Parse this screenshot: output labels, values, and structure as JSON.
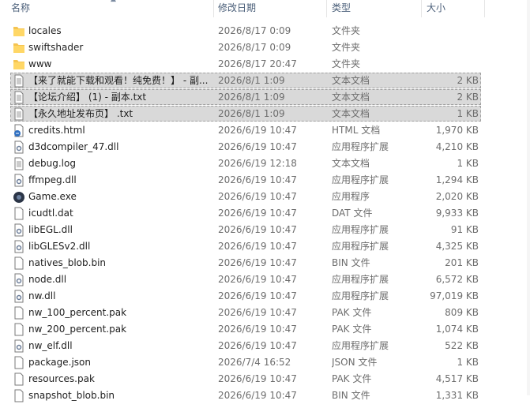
{
  "header": {
    "name": "名称",
    "date": "修改日期",
    "type": "类型",
    "size": "大小"
  },
  "rows": [
    {
      "name": "locales",
      "date": "2026/8/17 0:09",
      "type": "文件夹",
      "size": "",
      "icon": "folder-icon",
      "selected": false
    },
    {
      "name": "swiftshader",
      "date": "2026/8/17 0:09",
      "type": "文件夹",
      "size": "",
      "icon": "folder-icon",
      "selected": false
    },
    {
      "name": "www",
      "date": "2026/8/17 20:47",
      "type": "文件夹",
      "size": "",
      "icon": "folder-icon",
      "selected": false
    },
    {
      "name": "【来了就能下载和观看！纯免费！】 - 副...",
      "date": "2026/8/1 1:09",
      "type": "文本文档",
      "size": "2 KB",
      "icon": "text-file-icon",
      "selected": true
    },
    {
      "name": "【论坛介绍】 (1) - 副本.txt",
      "date": "2026/8/1 1:09",
      "type": "文本文档",
      "size": "2 KB",
      "icon": "text-file-icon",
      "selected": true
    },
    {
      "name": "【永久地址发布页】 .txt",
      "date": "2026/8/1 1:09",
      "type": "文本文档",
      "size": "1 KB",
      "icon": "text-file-icon",
      "selected": true
    },
    {
      "name": "credits.html",
      "date": "2026/6/19 10:47",
      "type": "HTML 文档",
      "size": "1,970 KB",
      "icon": "html-file-icon",
      "selected": false
    },
    {
      "name": "d3dcompiler_47.dll",
      "date": "2026/6/19 10:47",
      "type": "应用程序扩展",
      "size": "4,210 KB",
      "icon": "dll-file-icon",
      "selected": false
    },
    {
      "name": "debug.log",
      "date": "2026/6/19 12:18",
      "type": "文本文档",
      "size": "1 KB",
      "icon": "text-file-icon",
      "selected": false
    },
    {
      "name": "ffmpeg.dll",
      "date": "2026/6/19 10:47",
      "type": "应用程序扩展",
      "size": "1,294 KB",
      "icon": "dll-file-icon",
      "selected": false
    },
    {
      "name": "Game.exe",
      "date": "2026/6/19 10:47",
      "type": "应用程序",
      "size": "2,020 KB",
      "icon": "exe-file-icon",
      "selected": false
    },
    {
      "name": "icudtl.dat",
      "date": "2026/6/19 10:47",
      "type": "DAT 文件",
      "size": "9,933 KB",
      "icon": "blank-file-icon",
      "selected": false
    },
    {
      "name": "libEGL.dll",
      "date": "2026/6/19 10:47",
      "type": "应用程序扩展",
      "size": "91 KB",
      "icon": "dll-file-icon",
      "selected": false
    },
    {
      "name": "libGLESv2.dll",
      "date": "2026/6/19 10:47",
      "type": "应用程序扩展",
      "size": "4,325 KB",
      "icon": "dll-file-icon",
      "selected": false
    },
    {
      "name": "natives_blob.bin",
      "date": "2026/6/19 10:47",
      "type": "BIN 文件",
      "size": "201 KB",
      "icon": "blank-file-icon",
      "selected": false
    },
    {
      "name": "node.dll",
      "date": "2026/6/19 10:47",
      "type": "应用程序扩展",
      "size": "6,572 KB",
      "icon": "dll-file-icon",
      "selected": false
    },
    {
      "name": "nw.dll",
      "date": "2026/6/19 10:47",
      "type": "应用程序扩展",
      "size": "97,019 KB",
      "icon": "dll-file-icon",
      "selected": false
    },
    {
      "name": "nw_100_percent.pak",
      "date": "2026/6/19 10:47",
      "type": "PAK 文件",
      "size": "809 KB",
      "icon": "blank-file-icon",
      "selected": false
    },
    {
      "name": "nw_200_percent.pak",
      "date": "2026/6/19 10:47",
      "type": "PAK 文件",
      "size": "1,074 KB",
      "icon": "blank-file-icon",
      "selected": false
    },
    {
      "name": "nw_elf.dll",
      "date": "2026/6/19 10:47",
      "type": "应用程序扩展",
      "size": "522 KB",
      "icon": "dll-file-icon",
      "selected": false
    },
    {
      "name": "package.json",
      "date": "2026/7/4 16:52",
      "type": "JSON 文件",
      "size": "1 KB",
      "icon": "blank-file-icon",
      "selected": false
    },
    {
      "name": "resources.pak",
      "date": "2026/6/19 10:47",
      "type": "PAK 文件",
      "size": "4,517 KB",
      "icon": "blank-file-icon",
      "selected": false
    },
    {
      "name": "snapshot_blob.bin",
      "date": "2026/6/19 10:47",
      "type": "BIN 文件",
      "size": "1,331 KB",
      "icon": "blank-file-icon",
      "selected": false
    }
  ]
}
